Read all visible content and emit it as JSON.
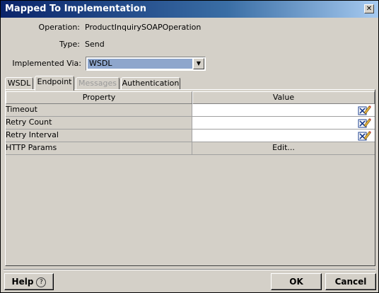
{
  "window": {
    "title": "Mapped To Implementation",
    "close_glyph": "✕"
  },
  "form": {
    "operation_label": "Operation:",
    "operation_value": "ProductInquirySOAPOperation",
    "type_label": "Type:",
    "type_value": "Send",
    "implemented_label": "Implemented Via:",
    "implemented_value": "WSDL",
    "dropdown_glyph": "▼"
  },
  "tabs": [
    {
      "label": "WSDL",
      "state": "normal"
    },
    {
      "label": "Endpoint",
      "state": "active"
    },
    {
      "label": "Messages",
      "state": "disabled"
    },
    {
      "label": "Authentication",
      "state": "normal"
    }
  ],
  "grid": {
    "headers": [
      "Property",
      "Value"
    ],
    "rows": [
      {
        "property": "Timeout",
        "value": "",
        "has_edit_icon": true
      },
      {
        "property": "Retry Count",
        "value": "",
        "has_edit_icon": true
      },
      {
        "property": "Retry Interval",
        "value": "",
        "has_edit_icon": true
      },
      {
        "property": "HTTP Params",
        "value": "Edit...",
        "has_edit_icon": false
      }
    ]
  },
  "buttons": {
    "help": "Help",
    "help_icon": "?",
    "ok": "OK",
    "cancel": "Cancel"
  },
  "colors": {
    "title_bar_start": "#0a246a",
    "dialog_background": "#d4d0c8",
    "selected_combo": "#8ea6cc"
  }
}
